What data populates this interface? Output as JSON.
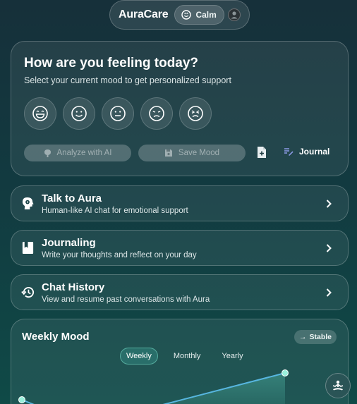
{
  "header": {
    "brand": "AuraCare",
    "mood_label": "Calm",
    "mood_icon": "smile-face-icon",
    "avatar_icon": "user-avatar-icon"
  },
  "mood_checkin": {
    "title": "How are you feeling today?",
    "subtitle": "Select your current mood to get personalized support",
    "moods": [
      {
        "name": "very-happy"
      },
      {
        "name": "happy"
      },
      {
        "name": "neutral"
      },
      {
        "name": "sad"
      },
      {
        "name": "very-sad"
      }
    ],
    "analyze_label": "Analyze with AI",
    "save_label": "Save Mood",
    "journal_label": "Journal"
  },
  "features": [
    {
      "title": "Talk to Aura",
      "subtitle": "Human-like AI chat for emotional support",
      "icon": "brain-head-icon"
    },
    {
      "title": "Journaling",
      "subtitle": "Write your thoughts and reflect on your day",
      "icon": "book-icon"
    },
    {
      "title": "Chat History",
      "subtitle": "View and resume past conversations with Aura",
      "icon": "history-icon"
    }
  ],
  "weekly_mood": {
    "title": "Weekly Mood",
    "trend_label": "Stable",
    "tabs": [
      "Weekly",
      "Monthly",
      "Yearly"
    ],
    "active_tab": "Weekly"
  },
  "colors": {
    "accent": "#5fd4c0",
    "line": "#57b6e0"
  }
}
